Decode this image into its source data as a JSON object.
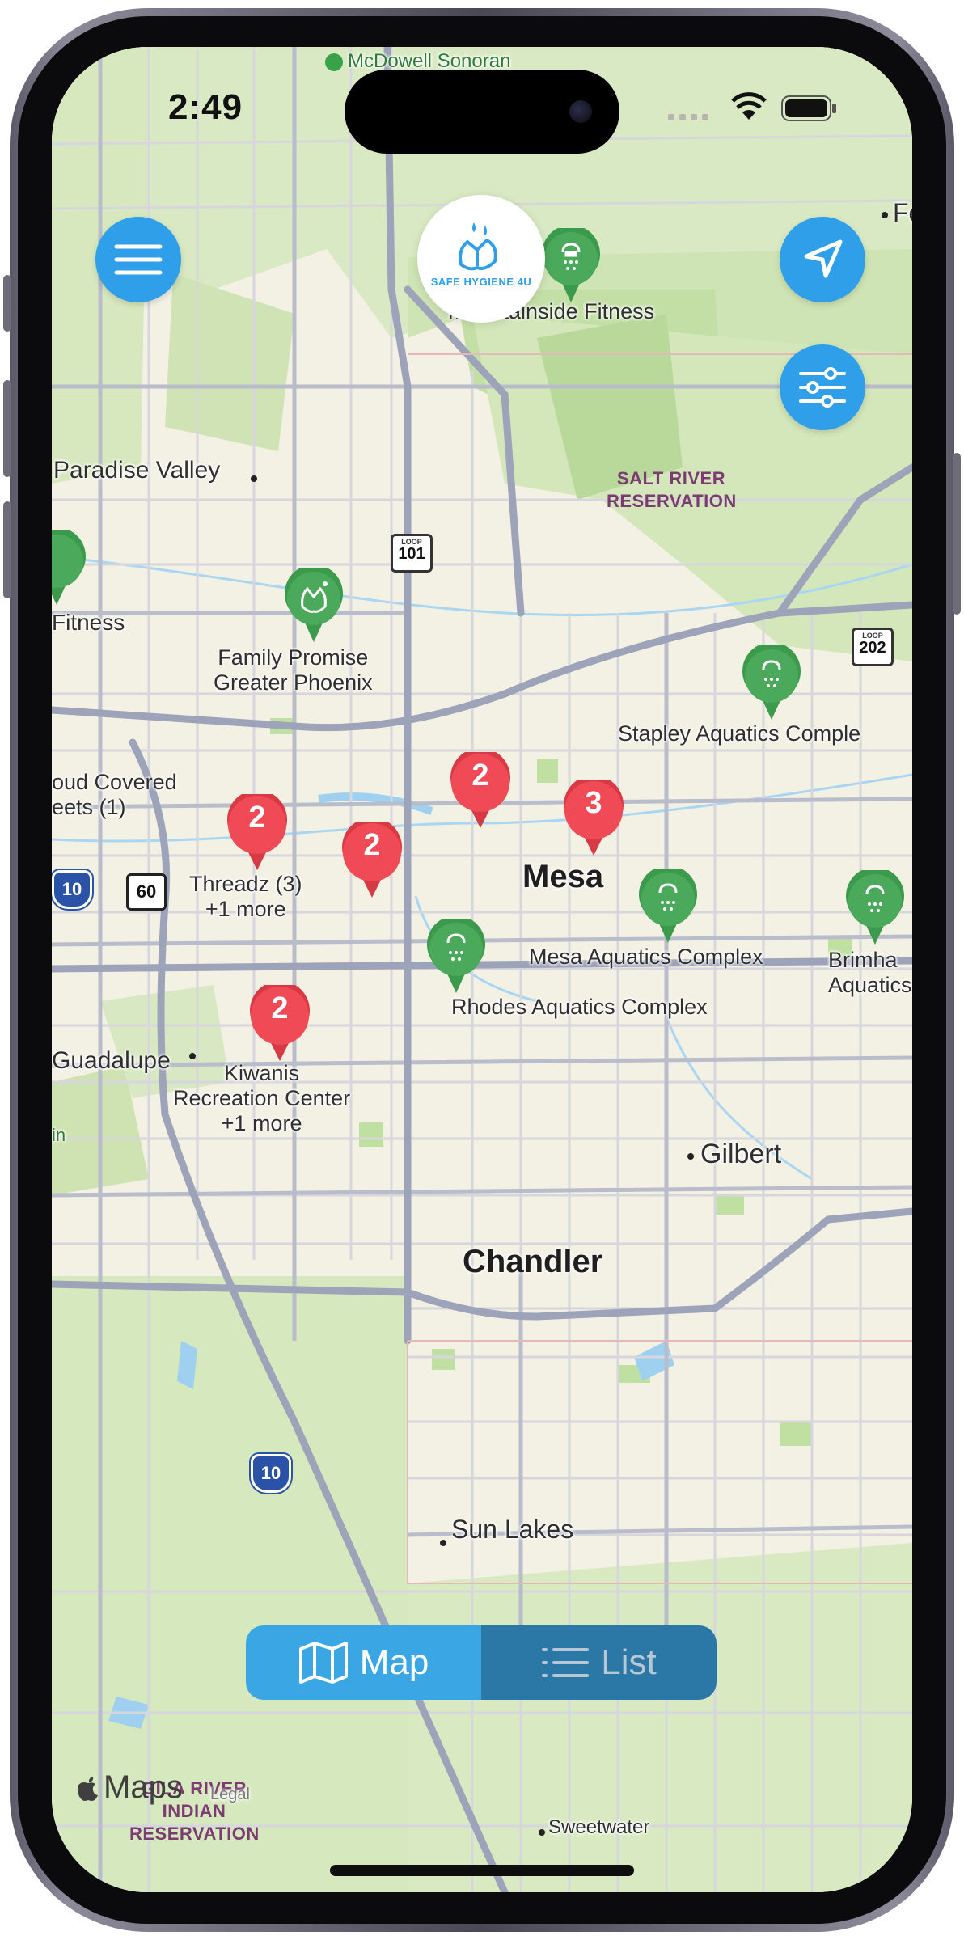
{
  "status_bar": {
    "time": "2:49"
  },
  "app": {
    "logo_text": "SAFE HYGIENE 4U"
  },
  "buttons": {
    "menu": "hamburger-menu-icon",
    "locate": "location-arrow-icon",
    "filter": "sliders-icon"
  },
  "segment": {
    "map_label": "Map",
    "list_label": "List",
    "selected": "Map"
  },
  "credit": {
    "text": "Maps",
    "legal": "Legal"
  },
  "cluster_pins": [
    {
      "count": "2",
      "name": "pin-cluster-threadz"
    },
    {
      "count": "2",
      "name": "pin-cluster-central"
    },
    {
      "count": "2",
      "name": "pin-cluster-north-mesa"
    },
    {
      "count": "3",
      "name": "pin-cluster-mesa"
    },
    {
      "count": "2",
      "name": "pin-cluster-kiwanis"
    }
  ],
  "place_labels": {
    "mountainside": "Mountainside Fitness",
    "fitness_left": "Fitness",
    "family_promise_1": "Family Promise",
    "family_promise_2": "Greater Phoenix",
    "stapley": "Stapley Aquatics Comple",
    "cloud_covered_1": "oud Covered",
    "cloud_covered_2": "eets (1)",
    "threadz": "Threadz (3)",
    "threadz_more": "+1 more",
    "mesa_aquatics": "Mesa Aquatics Complex",
    "brimhall_1": "Brimha",
    "brimhall_2": "Aquatics Co",
    "rhodes": "Rhodes Aquatics Complex",
    "kiwanis_1": "Kiwanis",
    "kiwanis_2": "Recreation Center",
    "kiwanis_more": "+1 more",
    "mcdowell": "McDowell Sonoran",
    "fo": "Fo"
  },
  "city_labels": {
    "paradise_valley": "Paradise Valley",
    "mesa": "Mesa",
    "gilbert": "Gilbert",
    "chandler": "Chandler",
    "guadalupe": "Guadalupe",
    "sun_lakes": "Sun Lakes",
    "sweetwater": "Sweetwater",
    "in_edge": "in"
  },
  "reservations": {
    "salt_river_1": "SALT RIVER",
    "salt_river_2": "RESERVATION",
    "gila_1": "GILA RIVER",
    "gila_2": "INDIAN",
    "gila_3": "RESERVATION"
  },
  "highway_shields": {
    "loop101": "101",
    "loop202": "202",
    "i10_west": "10",
    "us60": "60",
    "i10_south": "10",
    "loop_word": "LOOP"
  }
}
